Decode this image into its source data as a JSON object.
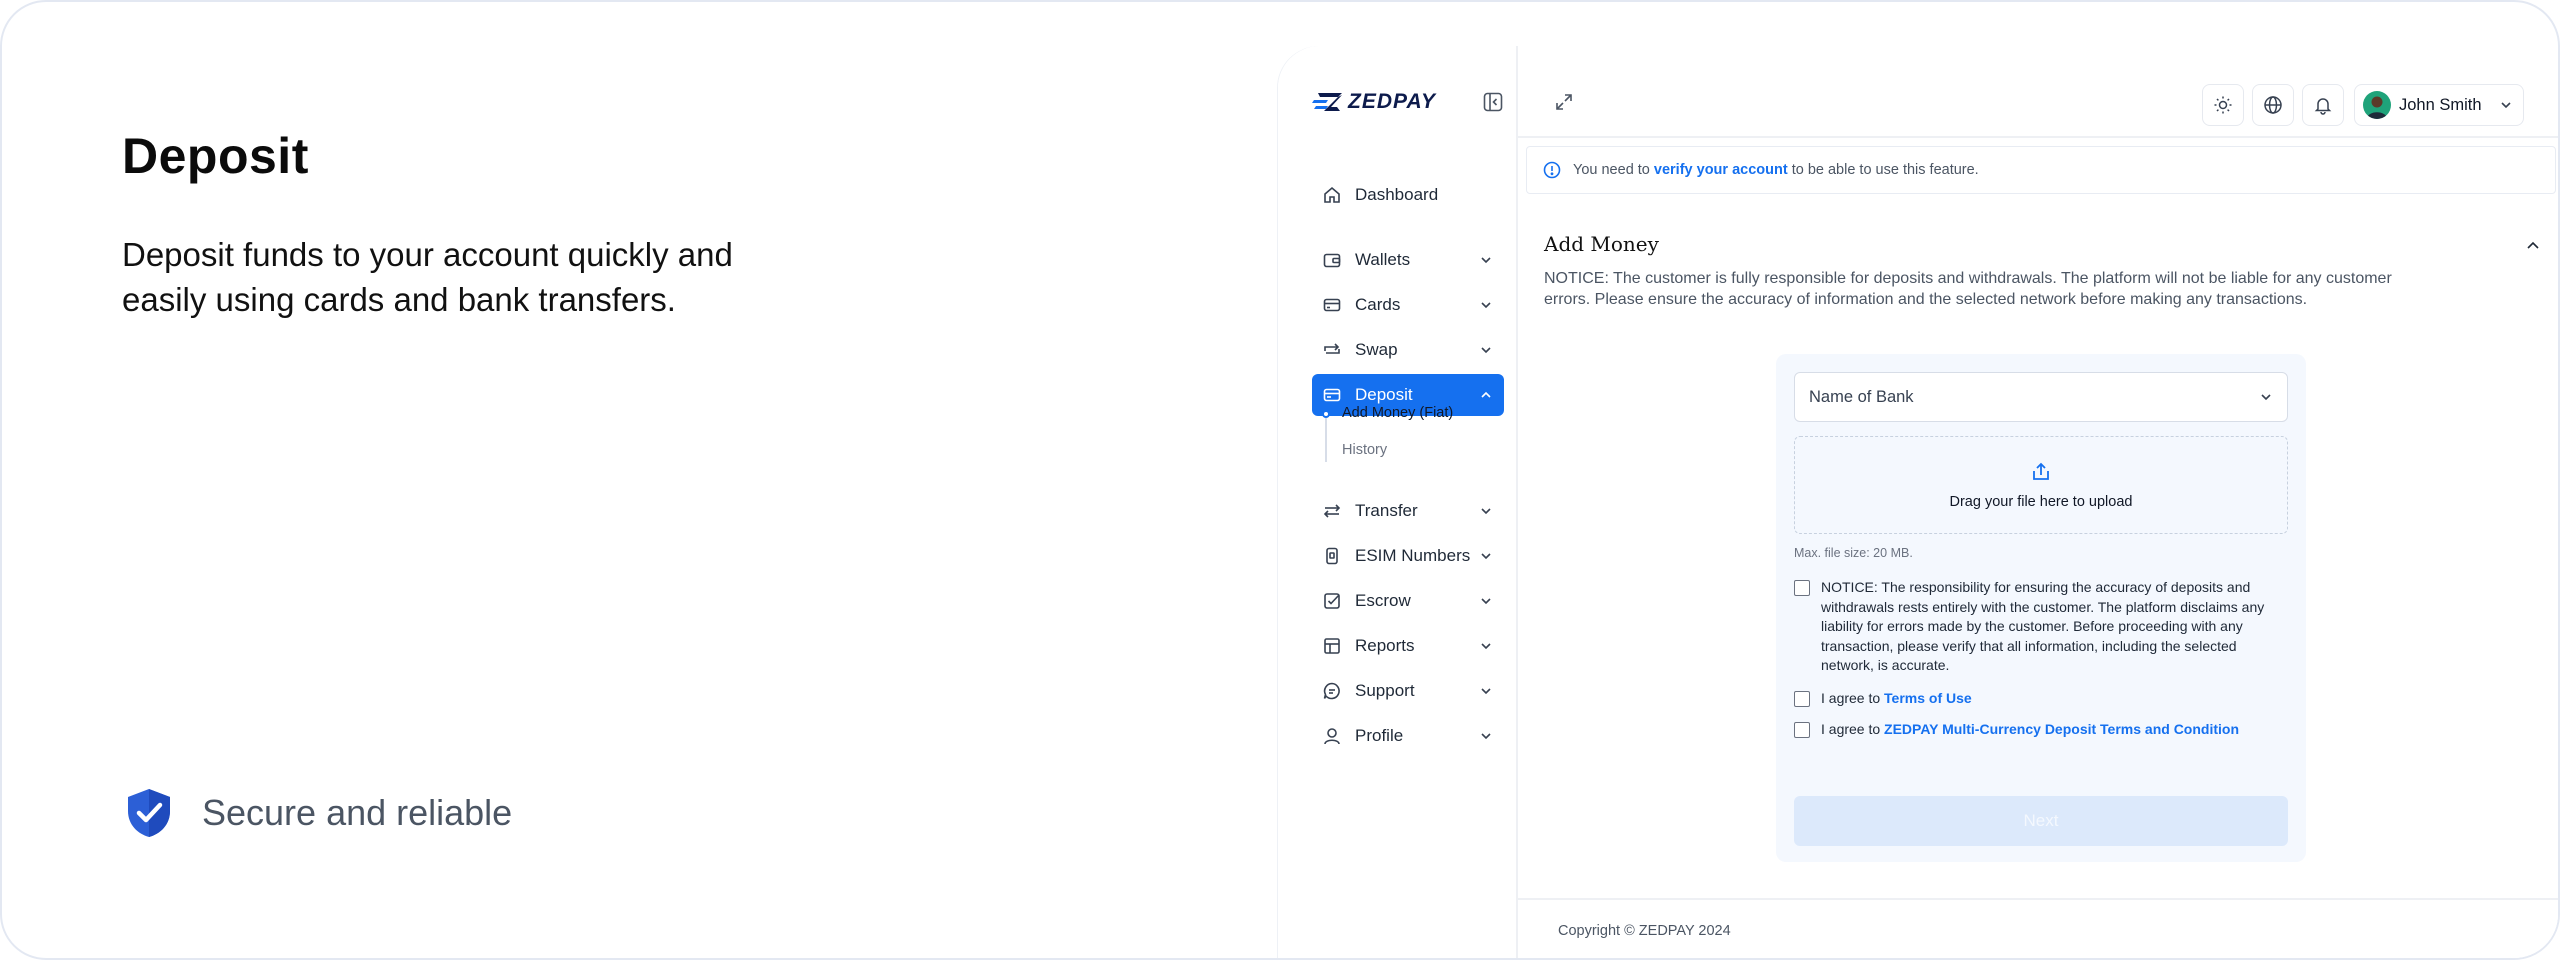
{
  "promo": {
    "title": "Deposit",
    "description": "Deposit funds to your account quickly and easily using cards and bank transfers.",
    "feature_label": "Secure and reliable"
  },
  "app": {
    "logo_text": "ZEDPAY",
    "nav": [
      {
        "label": "Dashboard",
        "icon": "home-icon"
      },
      {
        "label": "Wallets",
        "icon": "wallet-icon"
      },
      {
        "label": "Cards",
        "icon": "card-icon"
      },
      {
        "label": "Swap",
        "icon": "swap-icon"
      },
      {
        "label": "Deposit",
        "icon": "deposit-icon",
        "active": true
      },
      {
        "label": "Transfer",
        "icon": "transfer-icon"
      },
      {
        "label": "ESIM Numbers",
        "icon": "esim-icon"
      },
      {
        "label": "Escrow",
        "icon": "escrow-icon"
      },
      {
        "label": "Reports",
        "icon": "reports-icon"
      },
      {
        "label": "Support",
        "icon": "support-icon"
      },
      {
        "label": "Profile",
        "icon": "profile-icon"
      }
    ],
    "deposit_sub": [
      {
        "label": "Add Money (Fiat)",
        "active": true
      },
      {
        "label": "History",
        "active": false
      }
    ],
    "user_name": "John Smith",
    "alert": {
      "prefix": "You need to ",
      "link": "verify your account",
      "suffix": " to be able to use this feature."
    },
    "section_title": "Add Money",
    "notice": "NOTICE: The customer is fully  responsible for deposits and withdrawals. The platform will not be  liable for any customer errors. Please ensure the accuracy of  information and the selected network before making any transactions.",
    "form": {
      "bank_placeholder": "Name of Bank",
      "upload_label": "Drag your file here to upload",
      "max_size": "Max. file size: 20 MB.",
      "notice_check": "NOTICE: The responsibility for ensuring the accuracy of deposits and withdrawals rests entirely with the customer. The platform disclaims any liability for errors made by the customer. Before proceeding with any transaction, please verify that all information, including the selected network, is accurate.",
      "agree_prefix": "I agree to ",
      "terms_link": "Terms of Use",
      "deposit_terms_link": "ZEDPAY Multi-Currency Deposit Terms and Condition",
      "next_label": "Next"
    },
    "footer": "Copyright © ZEDPAY 2024"
  },
  "colors": {
    "primary": "#1570ef",
    "shield": "#2c5fd6",
    "logo_navy": "#0d1b4c"
  }
}
